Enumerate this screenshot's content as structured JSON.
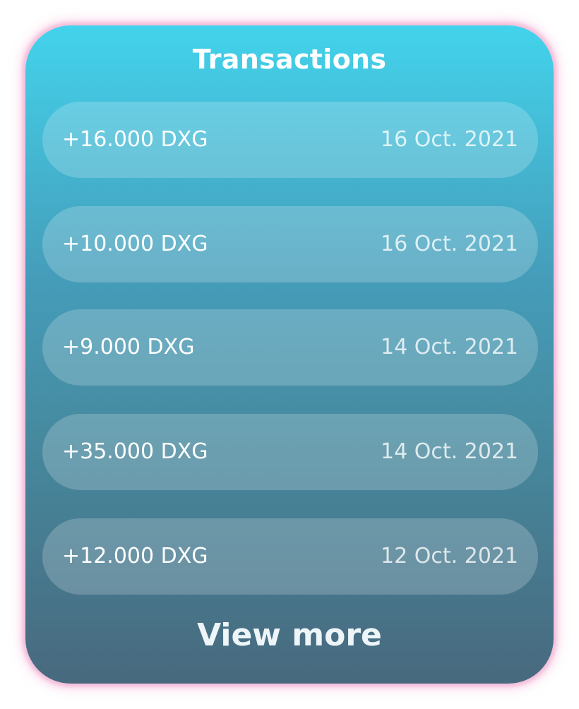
{
  "widget": {
    "title": "Transactions",
    "view_more_label": "View more"
  },
  "transactions": [
    {
      "amount": "+16.000 DXG",
      "date": "16 Oct. 2021"
    },
    {
      "amount": "+10.000 DXG",
      "date": "16 Oct. 2021"
    },
    {
      "amount": "+9.000 DXG",
      "date": "14 Oct. 2021"
    },
    {
      "amount": "+35.000 DXG",
      "date": "14 Oct. 2021"
    },
    {
      "amount": "+12.000 DXG",
      "date": "12 Oct. 2021"
    }
  ],
  "colors": {
    "gradient_top": "#43d3ec",
    "gradient_bottom": "#48697e",
    "glow": "#f4bcd9"
  }
}
